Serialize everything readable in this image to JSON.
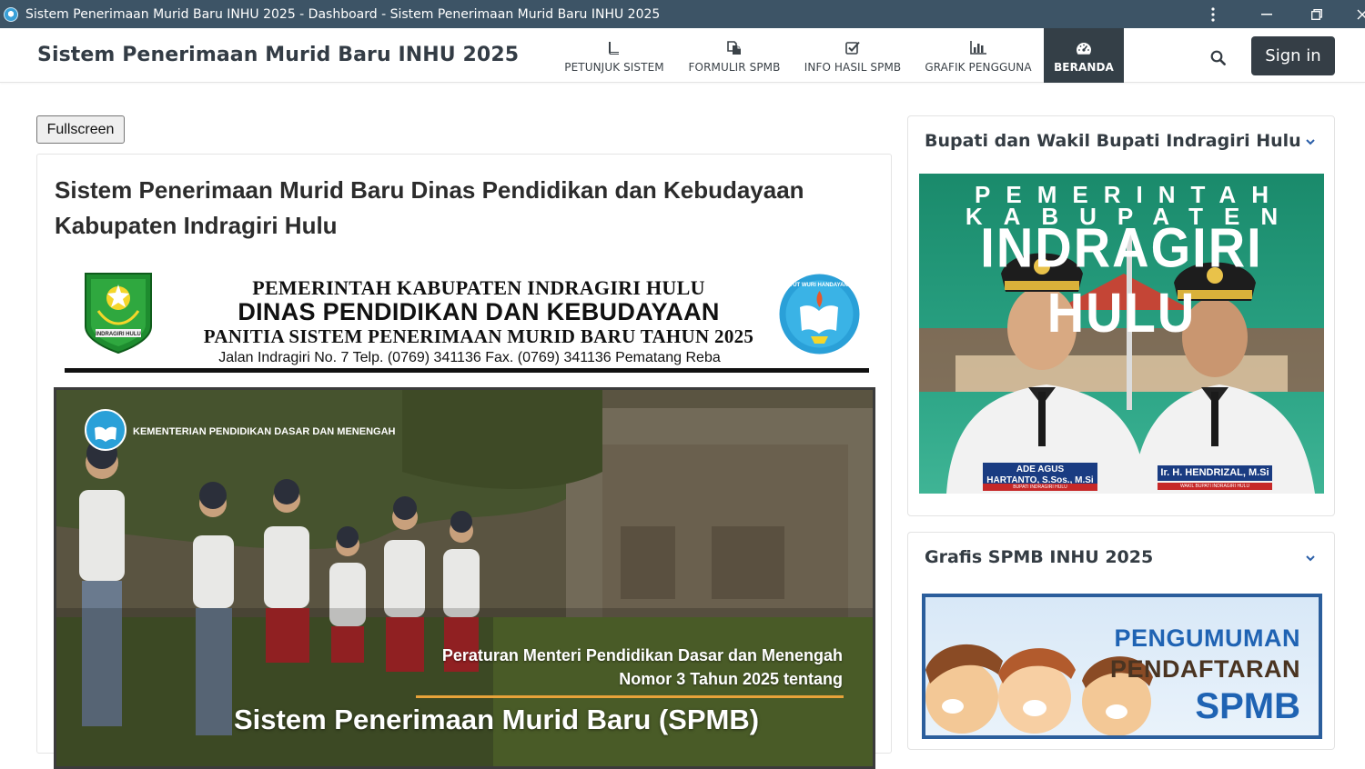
{
  "browser": {
    "window_title": "Sistem Penerimaan Murid Baru INHU 2025 - Dashboard - Sistem Penerimaan Murid Baru INHU 2025"
  },
  "navbar": {
    "brand": "Sistem Penerimaan Murid Baru INHU 2025",
    "items": [
      {
        "label": "PETUNJUK SISTEM",
        "icon": "book-icon"
      },
      {
        "label": "FORMULIR SPMB",
        "icon": "copy-icon"
      },
      {
        "label": "INFO HASIL SPMB",
        "icon": "check-square-icon"
      },
      {
        "label": "GRAFIK PENGGUNA",
        "icon": "bar-chart-icon"
      },
      {
        "label": "BERANDA",
        "icon": "dashboard-icon",
        "active": true
      }
    ],
    "signin": "Sign in"
  },
  "main": {
    "fullscreen_label": "Fullscreen",
    "title": "Sistem Penerimaan Murid Baru Dinas Pendidikan dan Kebudayaan Kabupaten Indragiri Hulu",
    "kop": {
      "line1": "PEMERINTAH KABUPATEN INDRAGIRI HULU",
      "line2": "DINAS PENDIDIKAN DAN KEBUDAYAAN",
      "line3": "PANITIA SISTEM PENERIMAAN MURID BARU TAHUN 2025",
      "line4": "Jalan Indragiri No. 7 Telp. (0769) 341136 Fax. (0769) 341136 Pematang Reba",
      "logo_left_text": "INDRAGIRI HULU",
      "logo_right_text": "TUT WURI HANDAYANI"
    },
    "poster": {
      "ministry": "KEMENTERIAN PENDIDIKAN DASAR DAN MENENGAH",
      "line1": "Peraturan Menteri Pendidikan Dasar dan Menengah",
      "line2": "Nomor 3 Tahun 2025 tentang",
      "big": "Sistem Penerimaan Murid Baru (SPMB)"
    }
  },
  "sidebar": {
    "card1": {
      "title": "Bupati dan Wakil Bupati Indragiri Hulu",
      "img_line1": "PEMERINTAH",
      "img_line2": "KABUPATEN",
      "img_line3": "INDRAGIRI HULU",
      "left_name": "ADE AGUS HARTANTO, S.Sos., M.Si",
      "left_name_a": "ADE AGUS",
      "left_name_b": "HARTANTO, S.Sos., M.Si",
      "left_role": "BUPATI INDRAGIRI HULU",
      "right_name": "Ir. H. HENDRIZAL, M.Si",
      "right_role": "WAKIL BUPATI INDRAGIRI HULU"
    },
    "card2": {
      "title": "Grafis SPMB INHU 2025",
      "img_line1": "PENGUMUMAN",
      "img_line2": "PENDAFTARAN",
      "img_line3": "SPMB"
    }
  },
  "colors": {
    "titlebar": "#3d5466",
    "nav_active": "#343f47",
    "signin": "#353e46"
  }
}
